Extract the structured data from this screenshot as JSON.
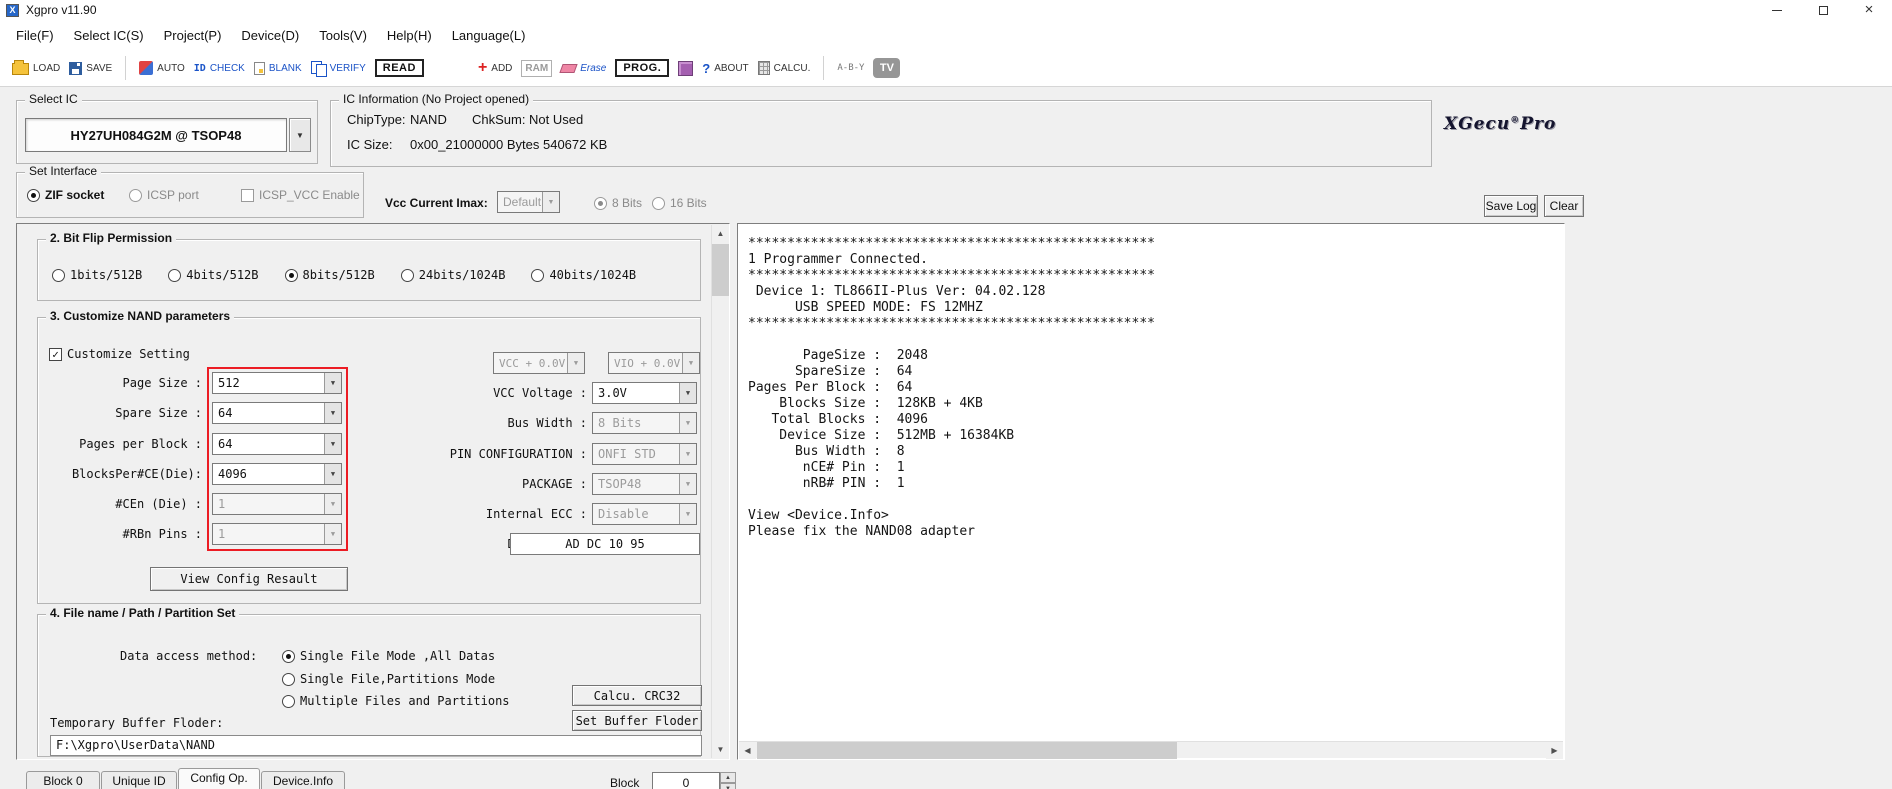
{
  "window": {
    "title": "Xgpro v11.90"
  },
  "menu": {
    "items": [
      "File(F)",
      "Select IC(S)",
      "Project(P)",
      "Device(D)",
      "Tools(V)",
      "Help(H)",
      "Language(L)"
    ]
  },
  "toolbar": {
    "load": "LOAD",
    "save": "SAVE",
    "auto": "AUTO",
    "check": "CHECK",
    "blank": "BLANK",
    "verify": "VERIFY",
    "read": "READ",
    "add": "ADD",
    "ram": "RAM",
    "erase": "Erase",
    "prog": "PROG.",
    "about": "ABOUT",
    "calcu": "CALCU.",
    "compare": "A-B-Y",
    "tv": "TV"
  },
  "select_ic": {
    "group_label": "Select IC",
    "value": "HY27UH084G2M @ TSOP48"
  },
  "ic_info": {
    "group_label": "IC Information (No Project opened)",
    "chip_type_label": "ChipType:",
    "chip_type_value": "NAND",
    "chksum_label": "ChkSum:",
    "chksum_value": "Not Used",
    "ic_size_label": "IC Size:",
    "ic_size_value": "0x00_21000000 Bytes 540672 KB"
  },
  "brand": {
    "name": "XGecu",
    "reg": "®",
    "suffix": "Pro"
  },
  "set_interface": {
    "group_label": "Set Interface",
    "zif_label": "ZIF socket",
    "zif_selected": true,
    "icsp_label": "ICSP port",
    "icsp_selected": false,
    "icsp_vcc_label": "ICSP_VCC Enable",
    "icsp_vcc_checked": false
  },
  "power": {
    "vcc_label": "Vcc Current Imax:",
    "vcc_value": "Default",
    "bits8_label": "8 Bits",
    "bits8_selected": true,
    "bits16_label": "16 Bits",
    "bits16_selected": false
  },
  "log_controls": {
    "save_log": "Save Log",
    "clear": "Clear"
  },
  "config_panel": {
    "bit_flip": {
      "title": "2. Bit Flip Permission",
      "options": [
        {
          "label": "1bits/512B",
          "selected": false
        },
        {
          "label": "4bits/512B",
          "selected": false
        },
        {
          "label": "8bits/512B",
          "selected": true
        },
        {
          "label": "24bits/1024B",
          "selected": false
        },
        {
          "label": "40bits/1024B",
          "selected": false
        }
      ]
    },
    "nand_params": {
      "title": "3. Customize NAND parameters",
      "customize_label": "Customize Setting",
      "customize_checked": true,
      "left_rows": [
        {
          "label": "Page Size :",
          "value": "512",
          "enabled": true
        },
        {
          "label": "Spare Size :",
          "value": "64",
          "enabled": true
        },
        {
          "label": "Pages per Block :",
          "value": "64",
          "enabled": true
        },
        {
          "label": "BlocksPer#CE(Die):",
          "value": "4096",
          "enabled": true
        },
        {
          "label": "#CEn (Die) :",
          "value": "1",
          "enabled": false
        },
        {
          "label": "#RBn Pins :",
          "value": "1",
          "enabled": false
        }
      ],
      "vcc_offset": "VCC + 0.0V",
      "vio_offset": "VIO + 0.0V",
      "right_rows": [
        {
          "label": "VCC Voltage :",
          "value": "3.0V",
          "enabled": true
        },
        {
          "label": "Bus Width :",
          "value": "8 Bits",
          "enabled": false
        },
        {
          "label": "PIN CONFIGURATION :",
          "value": "ONFI STD",
          "enabled": false
        },
        {
          "label": "PACKAGE :",
          "value": "TSOP48",
          "enabled": false
        },
        {
          "label": "Internal ECC :",
          "value": "Disable",
          "enabled": false
        }
      ],
      "device_id_label": "Device ID :",
      "device_id_value": "AD DC 10 95",
      "view_config_button": "View Config Resault"
    },
    "file_partition": {
      "title": "4. File name / Path / Partition Set",
      "method_label": "Data access method:",
      "methods": [
        {
          "label": "Single File Mode ,All Datas",
          "selected": true
        },
        {
          "label": "Single File,Partitions Mode",
          "selected": false
        },
        {
          "label": "Multiple Files and Partitions",
          "selected": false
        }
      ],
      "crc_button": "Calcu. CRC32",
      "buffer_button": "Set Buffer Floder",
      "temp_label": "Temporary Buffer Floder:",
      "temp_path": "F:\\Xgpro\\UserData\\NAND"
    }
  },
  "log": {
    "lines": [
      "****************************************************",
      "1 Programmer Connected.",
      "****************************************************",
      " Device 1: TL866II-Plus Ver: 04.02.128",
      "      USB SPEED MODE: FS 12MHZ",
      "****************************************************",
      "",
      "       PageSize :  2048",
      "      SpareSize :  64",
      "Pages Per Block :  64",
      "    Blocks Size :  128KB + 4KB",
      "   Total Blocks :  4096",
      "    Device Size :  512MB + 16384KB",
      "      Bus Width :  8",
      "       nCE# Pin :  1",
      "       nRB# PIN :  1",
      "",
      "View <Device.Info>",
      "Please fix the NAND08 adapter"
    ]
  },
  "tabs": {
    "items": [
      {
        "label": "Block 0",
        "active": false
      },
      {
        "label": "Unique ID",
        "active": false
      },
      {
        "label": "Config Op.",
        "active": true
      },
      {
        "label": "Device.Info",
        "active": false
      }
    ]
  },
  "buffer_nav": {
    "block_label": "Block",
    "spinner_value": "0"
  }
}
